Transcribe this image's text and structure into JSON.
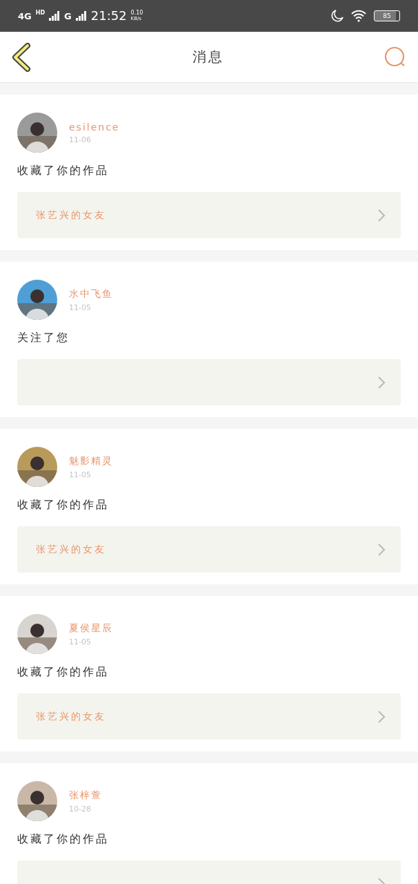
{
  "status_bar": {
    "network": "4G",
    "network_badge": "HD",
    "network_2": "G",
    "time": "21:52",
    "speed": "0.10",
    "speed_unit": "KB/s",
    "battery": "85"
  },
  "header": {
    "title": "消息"
  },
  "messages": [
    {
      "user": "esilence",
      "date": "11-06",
      "action": "收藏了你的作品",
      "target": "张艺兴的女友"
    },
    {
      "user": "水中飞鱼",
      "date": "11-05",
      "action": "关注了您"
    },
    {
      "user": "魅影精灵",
      "date": "11-05",
      "action": "收藏了你的作品",
      "target": "张艺兴的女友"
    },
    {
      "user": "夏侯星辰",
      "date": "11-05",
      "action": "收藏了你的作品",
      "target": "张艺兴的女友"
    },
    {
      "user": "张梓萱",
      "date": "10-28",
      "action": "收藏了你的作品"
    }
  ]
}
